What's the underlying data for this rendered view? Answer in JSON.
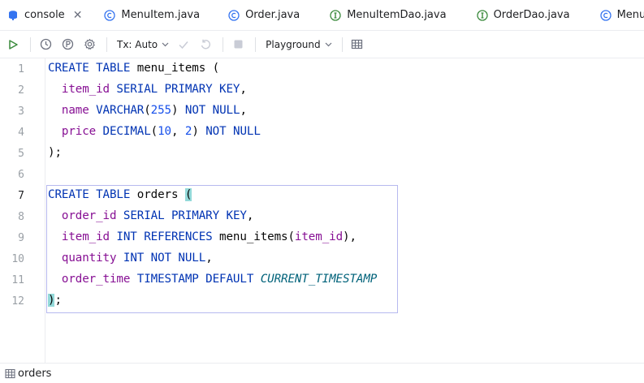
{
  "tabs": [
    {
      "label": "console",
      "icon": "database-console-icon",
      "active": true
    },
    {
      "label": "MenuItem.java",
      "icon": "class-icon"
    },
    {
      "label": "Order.java",
      "icon": "class-icon"
    },
    {
      "label": "MenuItemDao.java",
      "icon": "interface-icon"
    },
    {
      "label": "OrderDao.java",
      "icon": "interface-icon"
    },
    {
      "label": "MenuIt",
      "icon": "class-icon"
    }
  ],
  "tab_close_glyph": "✕",
  "toolbar": {
    "tx_mode": "Tx: Auto",
    "schema": "Playground"
  },
  "editor": {
    "line_numbers": [
      "1",
      "2",
      "3",
      "4",
      "5",
      "6",
      "7",
      "8",
      "9",
      "10",
      "11",
      "12"
    ],
    "current_line": "7"
  },
  "code": {
    "l1": {
      "kw": "CREATE TABLE",
      "name": " menu_items ",
      "paren": "("
    },
    "l2": {
      "fld": "item_id",
      "kw": " SERIAL PRIMARY KEY",
      "punct": ","
    },
    "l3": {
      "fld": "name",
      "kw1": " VARCHAR",
      "open": "(",
      "num": "255",
      "close": ")",
      "kw2": " NOT NULL",
      "punct": ","
    },
    "l4": {
      "fld": "price",
      "kw1": " DECIMAL",
      "open": "(",
      "num1": "10",
      "comma": ", ",
      "num2": "2",
      "close": ")",
      "kw2": " NOT NULL"
    },
    "l5": {
      "text": ");"
    },
    "l7": {
      "kw": "CREATE TABLE",
      "name": " orders ",
      "paren": "("
    },
    "l8": {
      "fld": "order_id",
      "kw": " SERIAL PRIMARY KEY",
      "punct": ","
    },
    "l9": {
      "fld": "item_id",
      "kw1": " INT REFERENCES",
      "ref": " menu_items",
      "open": "(",
      "fld2": "item_id",
      "close": "),"
    },
    "l10": {
      "fld": "quantity",
      "kw": " INT NOT NULL",
      "punct": ","
    },
    "l11": {
      "fld": "order_time",
      "kw": " TIMESTAMP DEFAULT ",
      "fn": "CURRENT_TIMESTAMP"
    },
    "l12": {
      "paren": ")",
      "punct": ";"
    }
  },
  "status": {
    "label": "orders",
    "icon": "table-icon"
  },
  "colors": {
    "keyword": "#0033b3",
    "field": "#871094",
    "number": "#1750eb",
    "function": "#00627a",
    "accent": "#3574f0",
    "bracket_highlight": "#93d9d9",
    "statement_border": "#b7b9ef"
  }
}
